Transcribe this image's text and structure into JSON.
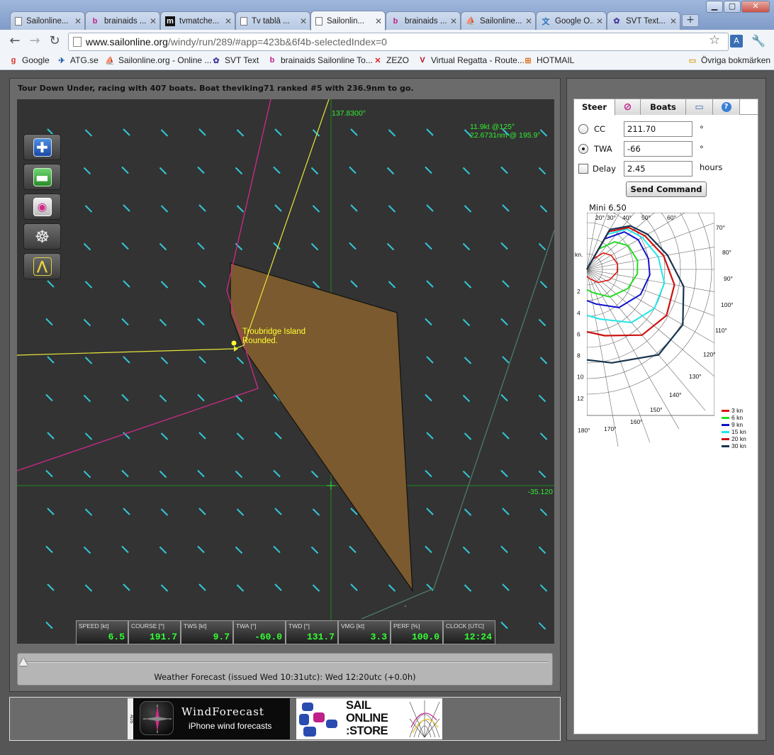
{
  "browser": {
    "tabs": [
      {
        "label": "Sailonline...",
        "icon": "page",
        "active": false
      },
      {
        "label": "brainaids ...",
        "icon": "brainaids",
        "active": false
      },
      {
        "label": "tvmatche...",
        "icon": "tvmatchen",
        "active": false
      },
      {
        "label": "Tv tablå ...",
        "icon": "page",
        "active": false
      },
      {
        "label": "Sailonlin...",
        "icon": "page",
        "active": true
      },
      {
        "label": "brainaids ...",
        "icon": "brainaids",
        "active": false
      },
      {
        "label": "Sailonline...",
        "icon": "sailonline",
        "active": false
      },
      {
        "label": "Google Ö...",
        "icon": "google-translate",
        "active": false
      },
      {
        "label": "SVT Text...",
        "icon": "svt",
        "active": false
      }
    ],
    "url_host": "www.sailonline.org",
    "url_path": "/windy/run/289/#app=423b&6f4b-selectedIndex=0",
    "bookmarks": [
      {
        "label": "Google",
        "icon": "google"
      },
      {
        "label": "ATG.se",
        "icon": "atg"
      },
      {
        "label": "Sailonline.org - Online ...",
        "icon": "sailonline"
      },
      {
        "label": "SVT Text",
        "icon": "svt"
      },
      {
        "label": "brainaids Sailonline To...",
        "icon": "brainaids"
      },
      {
        "label": "ZEZO",
        "icon": "zezo"
      },
      {
        "label": "Virtual Regatta - Route...",
        "icon": "virtual-regatta"
      },
      {
        "label": "HOTMAIL",
        "icon": "windows"
      }
    ],
    "other_bookmarks": "Övriga bokmärken"
  },
  "race": {
    "info": "Tour Down Under, racing with 407 boats. Boat theviking71 ranked #5 with 236.9nm to go."
  },
  "map": {
    "lon_label": "137.8300°",
    "lat_label": "-35.120",
    "wind_line1": "11.9kt @125°",
    "wind_line2": "22.6731nm @ 195.9°",
    "mark_label_line1": "Troubridge Island",
    "mark_label_line2": "Rounded.",
    "controls": [
      "zoom-in",
      "zoom-out",
      "center-boat",
      "steering-wheel",
      "measure-compass"
    ]
  },
  "instruments": [
    {
      "label": "SPEED [kt]",
      "value": "6.5"
    },
    {
      "label": "COURSE [°]",
      "value": "191.7"
    },
    {
      "label": "TWS [kt]",
      "value": "9.7"
    },
    {
      "label": "TWA [°]",
      "value": "-60.0"
    },
    {
      "label": "TWD [°]",
      "value": "131.7"
    },
    {
      "label": "VMG [kt]",
      "value": "3.3"
    },
    {
      "label": "PERF [%]",
      "value": "100.0"
    },
    {
      "label": "CLOCK [UTC]",
      "value": "12:24"
    }
  ],
  "forecast": {
    "text": "Weather Forecast  (issued Wed 10:31utc): Wed 12:20utc  (+0.0h)",
    "slider_fraction": 0
  },
  "ads": {
    "windforecast_side": "ADS",
    "windforecast_title": "WindForecast",
    "windforecast_sub": "iPhone wind forecasts",
    "store_line1": "SAIL",
    "store_line2": "ONLINE",
    "store_line3": ":STORE"
  },
  "steer": {
    "tabs": {
      "steer": "Steer",
      "boats": "Boats"
    },
    "cc_label": "CC",
    "cc_value": "211.70",
    "cc_unit": "°",
    "twa_label": "TWA",
    "twa_value": "-66",
    "twa_unit": "°",
    "delay_label": "Delay",
    "delay_value": "2.45",
    "delay_unit": "hours",
    "mode": "TWA",
    "send_label": "Send Command"
  },
  "polar": {
    "title": "Mini 6.50",
    "speed_axis_label": "kn.",
    "speed_ticks": [
      "2",
      "4",
      "6",
      "8",
      "10",
      "12"
    ],
    "angle_ticks": [
      "20°",
      "30°",
      "40°",
      "50°",
      "60°",
      "70°",
      "80°",
      "90°",
      "100°",
      "110°",
      "120°",
      "130°",
      "140°",
      "150°",
      "160°",
      "170°",
      "180°"
    ],
    "legend": [
      {
        "label": "3 kn",
        "color": "#dd1111"
      },
      {
        "label": "6 kn",
        "color": "#22dd22"
      },
      {
        "label": "9 kn",
        "color": "#1111cc"
      },
      {
        "label": "15 kn",
        "color": "#22e6e6"
      },
      {
        "label": "20 kn",
        "color": "#cc1111"
      },
      {
        "label": "30 kn",
        "color": "#18354e"
      }
    ]
  }
}
